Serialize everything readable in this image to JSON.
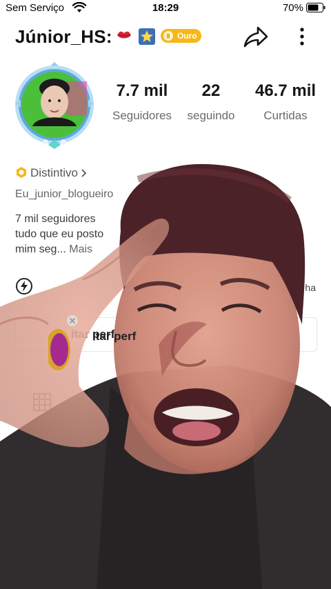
{
  "status_bar": {
    "carrier": "Sem Serviço",
    "time": "18:29",
    "battery_percent": "70%"
  },
  "header": {
    "username": "Júnior_HS:",
    "level_badge": "Ouro",
    "icons": [
      "lips-icon",
      "star-badge-icon",
      "share-icon",
      "more-icon"
    ]
  },
  "stats": [
    {
      "value": "7.7 mil",
      "label": "Seguidores"
    },
    {
      "value": "22",
      "label": "seguindo"
    },
    {
      "value": "46.7 mil",
      "label": "Curtidas"
    }
  ],
  "badge": {
    "label": "Distintivo",
    "icon": "badge-icon"
  },
  "handle": "Eu_junior_blogueiro",
  "bio": {
    "line1": "7 mil seguidores",
    "line2": "tudo que eu posto",
    "line3": "mim seg...",
    "more": "Mais"
  },
  "activity_text_right": "ha",
  "edit_profile": {
    "label": "itar perf"
  },
  "colors": {
    "gold_badge": "#f5b71a",
    "avatar_ring": "#5ea8dc",
    "avatar_bg": "#4bbf3a"
  },
  "overlay": {
    "description_icon": "video-overlay-face"
  }
}
